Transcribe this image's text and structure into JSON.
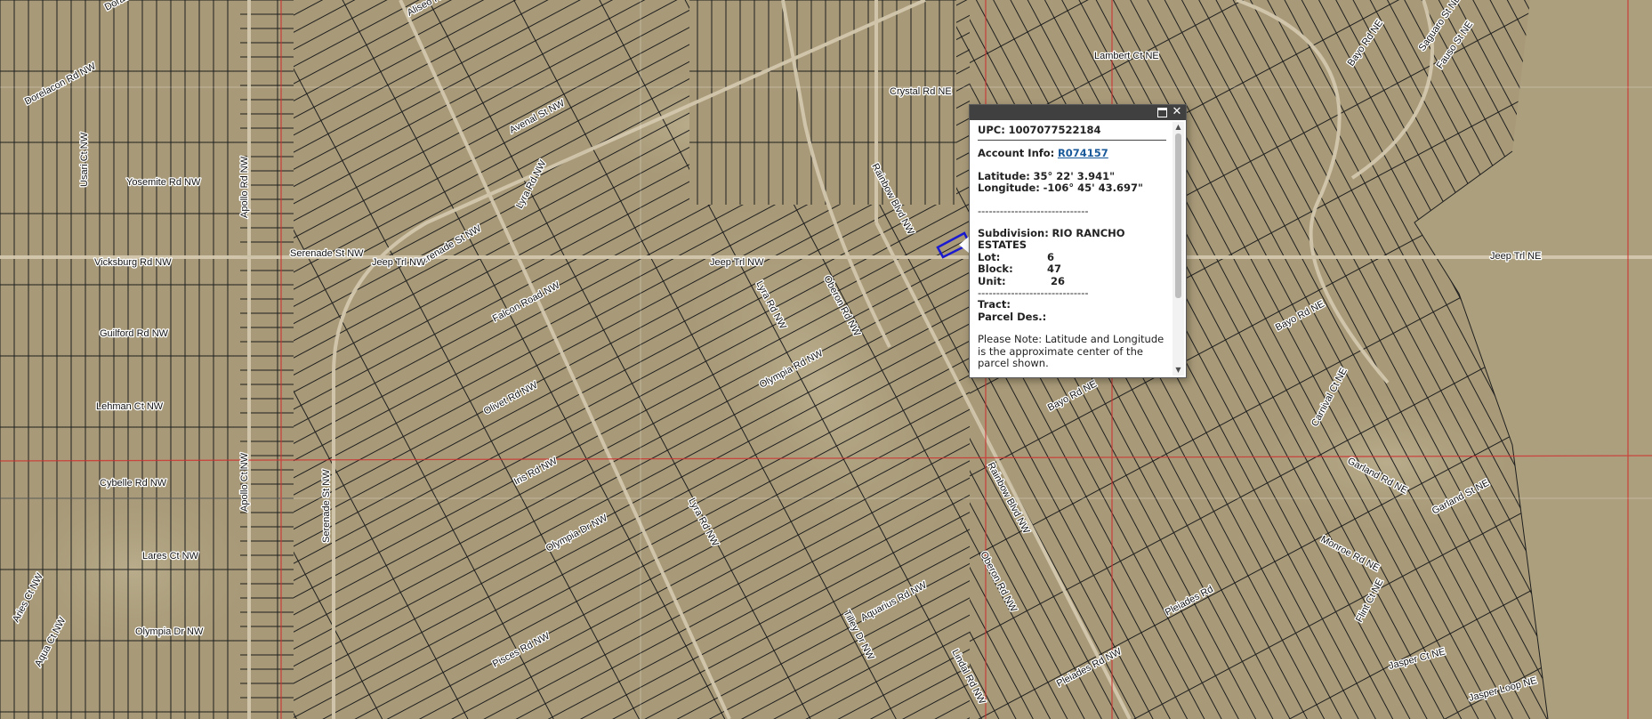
{
  "colors": {
    "terrain": "#a89a78",
    "parcel_line": "#1e1e1e",
    "boundary_red": "#d03030",
    "road": "#d3c8ae",
    "selected_parcel": "#1a1ad0",
    "popup_titlebar": "#404040",
    "link": "#1a5a9a"
  },
  "streets": [
    {
      "name": "Aliseo Rd NW",
      "rot": -28
    },
    {
      "name": "Dorado Rd NW",
      "rot": -28
    },
    {
      "name": "Dorelacon Rd NW",
      "rot": -28
    },
    {
      "name": "Yosemite Rd NW",
      "rot": 0
    },
    {
      "name": "Usari Ct NW",
      "rot": -90
    },
    {
      "name": "Vicksburg Rd NW",
      "rot": 0
    },
    {
      "name": "Guilford Rd NW",
      "rot": 0
    },
    {
      "name": "Lehman Ct NW",
      "rot": 0
    },
    {
      "name": "Cybelle Rd NW",
      "rot": 0
    },
    {
      "name": "Lares Ct NW",
      "rot": 0
    },
    {
      "name": "Olympia Dr NW",
      "rot": 0
    },
    {
      "name": "Apollo Rd NW",
      "rot": -90
    },
    {
      "name": "Apollo Ct NW",
      "rot": -90
    },
    {
      "name": "Serenade St NW",
      "rot": -90
    },
    {
      "name": "Serenade St NW",
      "rot": -30
    },
    {
      "name": "Serenade St NW",
      "rot": 0
    },
    {
      "name": "Jeep Trl NW",
      "rot": 0
    },
    {
      "name": "Jeep Trl NW",
      "rot": 0
    },
    {
      "name": "Jeep Trl NE",
      "rot": 0
    },
    {
      "name": "Lyra Rd NW",
      "rot": -62
    },
    {
      "name": "Avenal St NW",
      "rot": -28
    },
    {
      "name": "Falcon Road NW",
      "rot": -28
    },
    {
      "name": "Olivet Rd NW",
      "rot": -28
    },
    {
      "name": "Iris Rd NW",
      "rot": -28
    },
    {
      "name": "Olympia Dr NW",
      "rot": -28
    },
    {
      "name": "Lyra Rd NW",
      "rot": 62
    },
    {
      "name": "Lyra Rd NW",
      "rot": 62
    },
    {
      "name": "Olympia Rd NW",
      "rot": -28
    },
    {
      "name": "Crystal Rd NE",
      "rot": 0
    },
    {
      "name": "Lambert Ct NE",
      "rot": 0
    },
    {
      "name": "Rainbow Blvd NW",
      "rot": 62
    },
    {
      "name": "Rainbow Blvd NW",
      "rot": 62
    },
    {
      "name": "Oberon Rd NW",
      "rot": 62
    },
    {
      "name": "Oberon Rd NW",
      "rot": 62
    },
    {
      "name": "Aquarius Rd NW",
      "rot": -28
    },
    {
      "name": "Tilley Dr NW",
      "rot": 62
    },
    {
      "name": "Pisces Rd NW",
      "rot": -28
    },
    {
      "name": "Lindal Rd NW",
      "rot": 62
    },
    {
      "name": "Pleiades Rd NW",
      "rot": -28
    },
    {
      "name": "Pleiades Rd",
      "rot": -28
    },
    {
      "name": "Bayo Rd NE",
      "rot": -28
    },
    {
      "name": "Bayo Rd NE",
      "rot": -28
    },
    {
      "name": "Bayo Rd NE",
      "rot": -28
    },
    {
      "name": "Carnival Ct NE",
      "rot": -62
    },
    {
      "name": "Garland Rd NE",
      "rot": 28
    },
    {
      "name": "Garland St NE",
      "rot": -28
    },
    {
      "name": "Monroe Rd NE",
      "rot": 28
    },
    {
      "name": "Flint Ct NE",
      "rot": -62
    },
    {
      "name": "Jasper Ct NE",
      "rot": -15
    },
    {
      "name": "Jasper Loop NE",
      "rot": -15
    },
    {
      "name": "Saguaro St NE",
      "rot": -55
    },
    {
      "name": "Fauso St NE",
      "rot": -55
    },
    {
      "name": "Aqua Ct NW",
      "rot": -62
    },
    {
      "name": "Aries Ct NW",
      "rot": -62
    }
  ],
  "popup": {
    "upc_label": "UPC:",
    "upc_value": "1007077522184",
    "account_label": "Account Info:",
    "account_link": "R074157",
    "latitude_label": "Latitude:",
    "latitude_value": "35° 22' 3.941\"",
    "longitude_label": "Longitude:",
    "longitude_value": "-106° 45' 43.697\"",
    "divider": "------------------------------",
    "subdivision_label": "Subdivision:",
    "subdivision_value": "RIO RANCHO ESTATES",
    "lot_label": "Lot:",
    "lot_value": "6",
    "block_label": "Block:",
    "block_value": "47",
    "unit_label": "Unit:",
    "unit_value": "26",
    "tract_label": "Tract:",
    "tract_value": "",
    "parcel_label": "Parcel Des.:",
    "parcel_value": "",
    "note": "Please Note: Latitude and Longitude is the approximate center of the parcel shown.",
    "close_icon": "close-icon",
    "maximize_icon": "maximize-icon"
  }
}
